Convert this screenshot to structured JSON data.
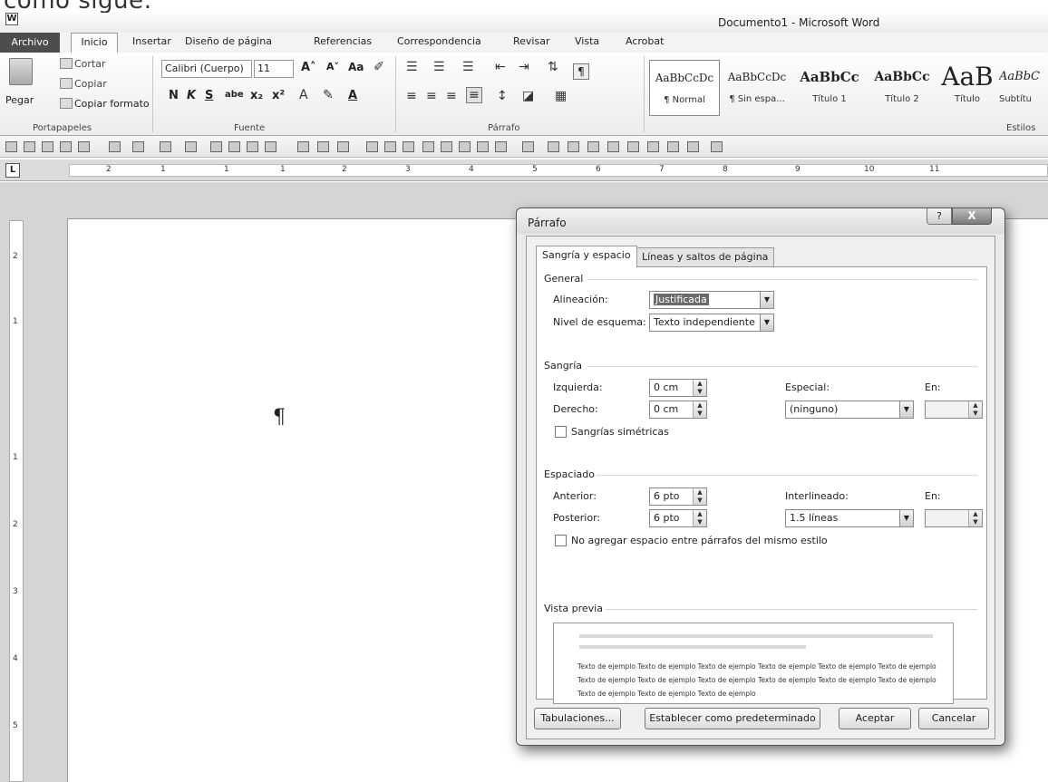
{
  "top_text": "como sigue:",
  "window": {
    "title": "Documento1 - Microsoft Word",
    "app_icon": "W"
  },
  "tabs": [
    "Archivo",
    "Inicio",
    "Insertar",
    "Diseño de página",
    "Referencias",
    "Correspondencia",
    "Revisar",
    "Vista",
    "Acrobat"
  ],
  "ribbon": {
    "clipboard": {
      "paste": "Pegar",
      "cut": "Cortar",
      "copy": "Copiar",
      "format_painter": "Copiar formato",
      "group": "Portapapeles"
    },
    "font": {
      "name": "Calibri (Cuerpo)",
      "size": "11",
      "group": "Fuente"
    },
    "paragraph": {
      "group": "Párrafo"
    },
    "styles": {
      "group": "Estilos",
      "items": [
        {
          "sample": "AaBbCcDc",
          "name": "¶ Normal"
        },
        {
          "sample": "AaBbCcDc",
          "name": "¶ Sin espa..."
        },
        {
          "sample": "AaBbCc",
          "name": "Título 1"
        },
        {
          "sample": "AaBbCc",
          "name": "Título 2"
        },
        {
          "sample": "AaB",
          "name": "Título"
        },
        {
          "sample": "AaBbC",
          "name": "Subtítu"
        }
      ]
    }
  },
  "ruler": {
    "corner": "L",
    "numbers": [
      "2",
      "1",
      "1",
      "1",
      "2",
      "3",
      "4",
      "5",
      "6",
      "7",
      "8",
      "9",
      "10",
      "11"
    ],
    "vertical": [
      "2",
      "1",
      "1",
      "2",
      "3",
      "4",
      "5"
    ]
  },
  "document": {
    "pilcrow": "¶"
  },
  "dialog": {
    "title": "Párrafo",
    "help": "?",
    "close": "X",
    "tabs": [
      "Sangría y espacio",
      "Líneas y saltos de página"
    ],
    "general": {
      "title": "General",
      "alignment_label": "Alineación:",
      "alignment_value": "Justificada",
      "outline_label": "Nivel de esquema:",
      "outline_value": "Texto independiente"
    },
    "indent": {
      "title": "Sangría",
      "left_label": "Izquierda:",
      "left_value": "0 cm",
      "right_label": "Derecho:",
      "right_value": "0 cm",
      "special_label": "Especial:",
      "special_value": "(ninguno)",
      "by_label": "En:",
      "mirror_label": "Sangrías simétricas"
    },
    "spacing": {
      "title": "Espaciado",
      "before_label": "Anterior:",
      "before_value": "6 pto",
      "after_label": "Posterior:",
      "after_value": "6 pto",
      "line_label": "Interlineado:",
      "line_value": "1.5 líneas",
      "at_label": "En:",
      "no_space_label": "No agregar espacio entre párrafos del mismo estilo"
    },
    "preview": {
      "title": "Vista previa",
      "sample_text": "Texto de ejemplo Texto de ejemplo Texto de ejemplo Texto de ejemplo Texto de ejemplo Texto de ejemplo Texto de ejemplo Texto de ejemplo Texto de ejemplo Texto de ejemplo Texto de ejemplo Texto de ejemplo Texto de ejemplo Texto de ejemplo Texto de ejemplo"
    },
    "buttons": {
      "tabs": "Tabulaciones...",
      "default": "Establecer como predeterminado",
      "ok": "Aceptar",
      "cancel": "Cancelar"
    }
  }
}
